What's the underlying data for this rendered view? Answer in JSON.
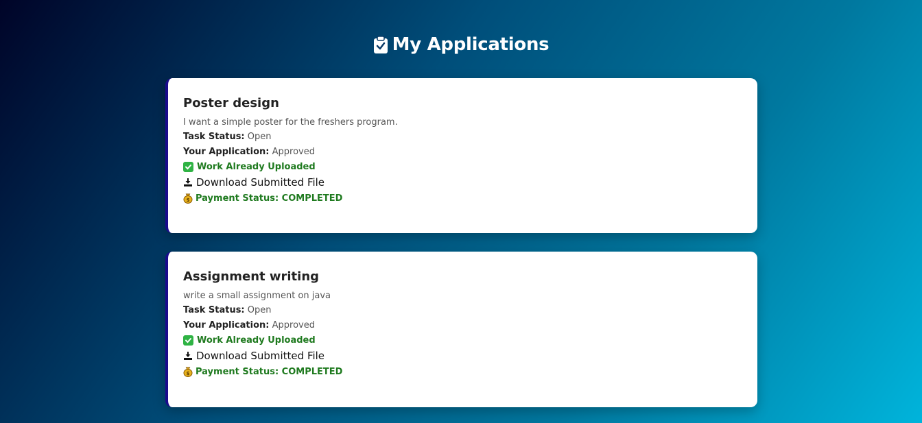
{
  "header": {
    "title": "My Applications",
    "icon": "clipboard-check-icon"
  },
  "applications": [
    {
      "title": "Poster design",
      "description": "I want a simple poster for the freshers program.",
      "task_status_label": "Task Status:",
      "task_status": "Open",
      "application_label": "Your Application:",
      "application_status": "Approved",
      "uploaded_text": "Work Already Uploaded",
      "download_text": "Download Submitted File",
      "payment_text": "Payment Status: COMPLETED"
    },
    {
      "title": "Assignment writing",
      "description": "write a small assignment on java",
      "task_status_label": "Task Status:",
      "task_status": "Open",
      "application_label": "Your Application:",
      "application_status": "Approved",
      "uploaded_text": "Work Already Uploaded",
      "download_text": "Download Submitted File",
      "payment_text": "Payment Status: COMPLETED"
    }
  ],
  "colors": {
    "accent_green": "#1f7a1f",
    "card_border": "#1a0a8c",
    "background_start": "#000428",
    "background_end": "#00b4db"
  }
}
